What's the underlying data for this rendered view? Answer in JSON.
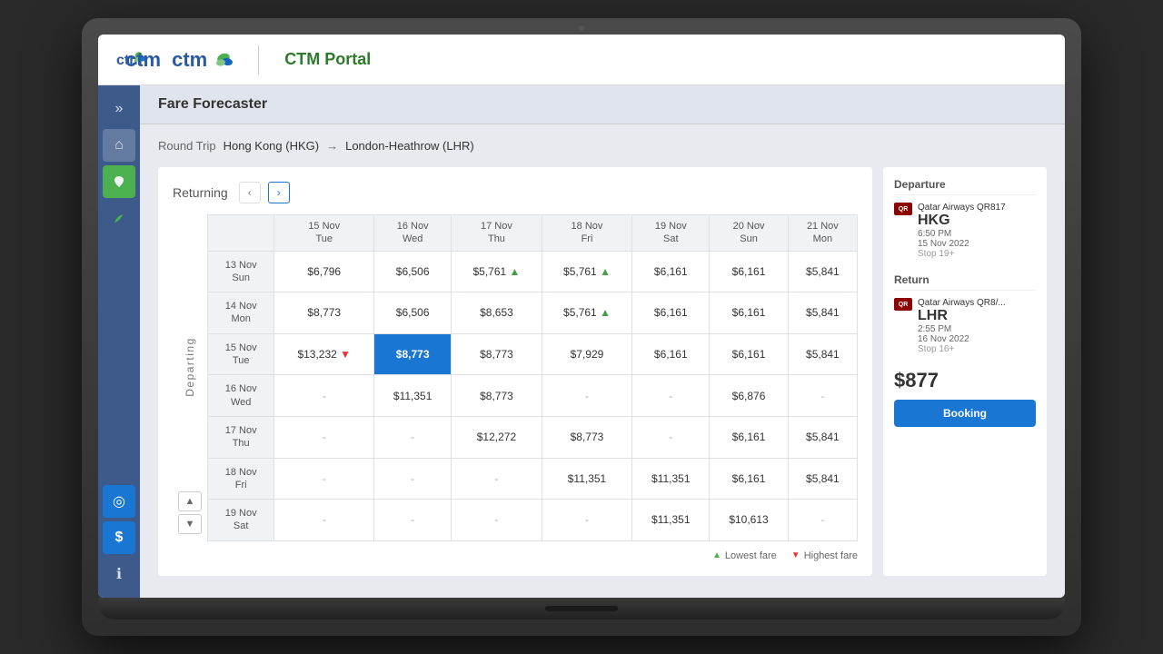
{
  "app": {
    "logo_text": "ctm",
    "portal_label": "Portal",
    "portal_brand": "CTM"
  },
  "page": {
    "title": "Fare Forecaster"
  },
  "breadcrumb": {
    "trip_type": "Round Trip",
    "origin": "Hong Kong (HKG)",
    "destination": "London-Heathrow (LHR)"
  },
  "table": {
    "returning_label": "Returning",
    "departing_label": "Departing",
    "prev_label": "‹",
    "next_label": "›",
    "col_headers": [
      {
        "date": "15 Nov",
        "day": "Tue"
      },
      {
        "date": "16 Nov",
        "day": "Wed"
      },
      {
        "date": "17 Nov",
        "day": "Thu"
      },
      {
        "date": "18 Nov",
        "day": "Fri"
      },
      {
        "date": "19 Nov",
        "day": "Sat"
      },
      {
        "date": "20 Nov",
        "day": "Sun"
      },
      {
        "date": "21 Nov",
        "day": "Mon"
      }
    ],
    "rows": [
      {
        "date": "13 Nov",
        "day": "Sun",
        "fares": [
          "$6,796",
          "$6,506",
          "$5,761",
          "$5,761",
          "$6,161",
          "$6,161",
          "$5,841"
        ],
        "indicators": [
          "",
          "",
          "low",
          "low",
          "",
          "",
          ""
        ]
      },
      {
        "date": "14 Nov",
        "day": "Mon",
        "fares": [
          "$8,773",
          "$6,506",
          "$8,653",
          "$5,761",
          "$6,161",
          "$6,161",
          "$5,841"
        ],
        "indicators": [
          "",
          "",
          "",
          "low",
          "",
          "",
          ""
        ]
      },
      {
        "date": "15 Nov",
        "day": "Tue",
        "fares": [
          "$13,232",
          "$8,773",
          "$8,773",
          "$7,929",
          "$6,161",
          "$6,161",
          "$5,841"
        ],
        "indicators": [
          "high",
          "",
          "",
          "",
          "",
          "",
          ""
        ],
        "selected": 1
      },
      {
        "date": "16 Nov",
        "day": "Wed",
        "fares": [
          "-",
          "$11,351",
          "$8,773",
          "-",
          "-",
          "$6,876",
          "-"
        ],
        "indicators": [
          "",
          "",
          "",
          "",
          "",
          "",
          ""
        ]
      },
      {
        "date": "17 Nov",
        "day": "Thu",
        "fares": [
          "-",
          "-",
          "$12,272",
          "$8,773",
          "-",
          "$6,161",
          "$5,841"
        ],
        "indicators": [
          "",
          "",
          "",
          "",
          "",
          "",
          ""
        ]
      },
      {
        "date": "18 Nov",
        "day": "Fri",
        "fares": [
          "-",
          "-",
          "-",
          "$11,351",
          "$11,351",
          "$6,161",
          "$5,841"
        ],
        "indicators": [
          "",
          "",
          "",
          "",
          "",
          "",
          ""
        ]
      },
      {
        "date": "19 Nov",
        "day": "Sat",
        "fares": [
          "-",
          "-",
          "-",
          "-",
          "$11,351",
          "$10,613",
          "-"
        ],
        "indicators": [
          "",
          "",
          "",
          "",
          "",
          "",
          ""
        ]
      }
    ]
  },
  "legend": {
    "lowest_label": "Lowest fare",
    "highest_label": "Highest fare"
  },
  "sidebar": {
    "departure_title": "Departure",
    "departure_airline": "Qatar Airways QR817",
    "departure_airport": "HKG",
    "departure_time": "6:50 PM",
    "departure_date": "15 Nov 2022",
    "departure_stops": "Stop",
    "departure_stop_count": "19+",
    "return_title": "Return",
    "return_airline": "Qatar Airways QR8/...",
    "return_airport": "LHR",
    "return_time": "2:55 PM",
    "return_date": "16 Nov 2022",
    "return_stops": "Stop",
    "return_stop_count": "16+",
    "price": "$877",
    "booking_label": "Booking"
  },
  "sidebar_icons": [
    {
      "name": "expand-icon",
      "symbol": "»"
    },
    {
      "name": "home-icon",
      "symbol": "⌂"
    },
    {
      "name": "plant-icon",
      "symbol": "🌿"
    },
    {
      "name": "leaf-icon",
      "symbol": "🍃"
    },
    {
      "name": "location-icon",
      "symbol": "◎"
    },
    {
      "name": "dollar-icon",
      "symbol": "$"
    },
    {
      "name": "info-icon",
      "symbol": "ℹ"
    }
  ]
}
